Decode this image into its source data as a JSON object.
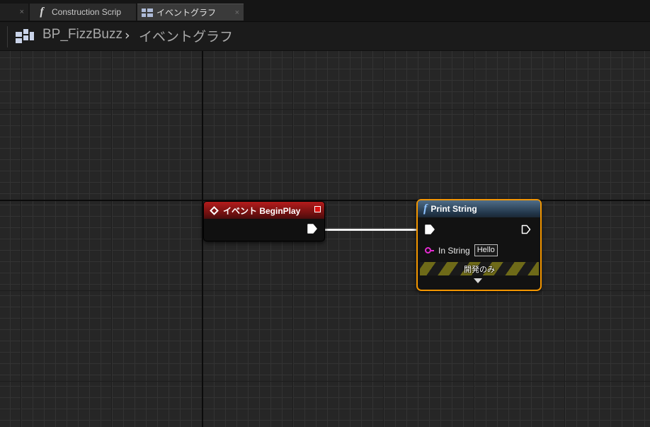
{
  "tabs": [
    {
      "label": "",
      "close": "×"
    },
    {
      "label": "Construction Scrip",
      "icon": "function-icon"
    },
    {
      "label": "イベントグラフ",
      "icon": "event-graph-icon",
      "close": "×",
      "active": true
    }
  ],
  "breadcrumb": {
    "blueprint": "BP_FizzBuzz",
    "separator": "›",
    "graph": "イベントグラフ"
  },
  "nodes": {
    "event_begin_play": {
      "title": "イベント BeginPlay",
      "header_color": "#b41c1c"
    },
    "print_string": {
      "title": "Print String",
      "fn_glyph": "f",
      "header_color": "#4f6d88",
      "selected_outline_color": "#f39600",
      "in_string_label": "In String",
      "in_string_value": "Hello",
      "dev_only_label": "開発のみ"
    }
  },
  "colors": {
    "string_pin": "#e52bd2",
    "exec_wire": "#f0f0f0"
  }
}
